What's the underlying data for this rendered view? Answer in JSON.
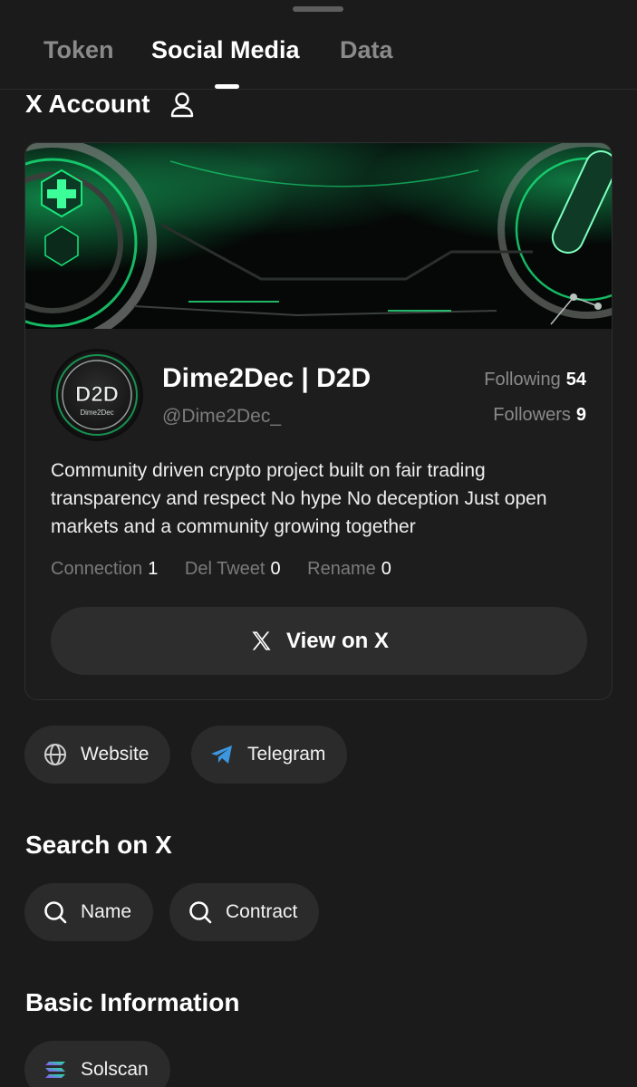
{
  "tabs": [
    {
      "label": "Token"
    },
    {
      "label": "Social Media"
    },
    {
      "label": "Data"
    }
  ],
  "x_account": {
    "title": "X Account",
    "profile": {
      "avatar_text": "D2D",
      "avatar_subtext": "Dime2Dec",
      "display_name": "Dime2Dec | D2D",
      "handle": "@Dime2Dec_",
      "following_label": "Following",
      "following_count": "54",
      "followers_label": "Followers",
      "followers_count": "9",
      "bio": "Community driven crypto project built on fair trading transparency and respect No hype No deception Just open markets and a community growing together",
      "connection_label": "Connection",
      "connection_value": "1",
      "del_tweet_label": "Del Tweet",
      "del_tweet_value": "0",
      "rename_label": "Rename",
      "rename_value": "0"
    },
    "view_button_label": "View on X"
  },
  "links": [
    {
      "label": "Website",
      "icon": "globe-icon"
    },
    {
      "label": "Telegram",
      "icon": "telegram-icon"
    }
  ],
  "search_on_x": {
    "title": "Search on X",
    "buttons": [
      {
        "label": "Name",
        "icon": "search-icon"
      },
      {
        "label": "Contract",
        "icon": "search-icon"
      }
    ]
  },
  "basic_information": {
    "title": "Basic Information",
    "buttons": [
      {
        "label": "Solscan",
        "icon": "solana-icon"
      }
    ]
  },
  "colors": {
    "background": "#1b1b1b",
    "card": "#1d1d1d",
    "pill": "#2b2b2b",
    "banner_accent": "#19e57a",
    "telegram_blue": "#3d96e0"
  }
}
